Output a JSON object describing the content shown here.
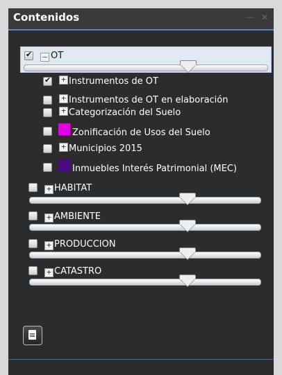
{
  "panel": {
    "title": "Contenidos"
  },
  "groups": [
    {
      "label": "OT",
      "checked": true,
      "expanded": true,
      "opacity_fraction": 0.65
    },
    {
      "label": "HABITAT",
      "checked": false,
      "expanded": false,
      "opacity_fraction": 0.65
    },
    {
      "label": "AMBIENTE",
      "checked": false,
      "expanded": false,
      "opacity_fraction": 0.65
    },
    {
      "label": "PRODUCCION",
      "checked": false,
      "expanded": false,
      "opacity_fraction": 0.65
    },
    {
      "label": "CATASTRO",
      "checked": false,
      "expanded": false,
      "opacity_fraction": 0.65
    }
  ],
  "ot_layers": [
    {
      "label": "Instrumentos de OT",
      "checked": true,
      "type": "expandable"
    },
    {
      "label": "Instrumentos de OT en elaboración",
      "checked": false,
      "type": "expandable"
    },
    {
      "label": "Categorización del Suelo",
      "checked": false,
      "type": "expandable"
    },
    {
      "label": "Zonificación de Usos del Suelo",
      "checked": false,
      "type": "swatch",
      "color": "#e100e6"
    },
    {
      "label": "Municipios 2015",
      "checked": false,
      "type": "expandable"
    },
    {
      "label": "Inmuebles Interés Patrimonial (MEC)",
      "checked": false,
      "type": "swatch",
      "color": "#4a0a84"
    }
  ],
  "colors": {
    "header_bg": "#3a3a3a",
    "panel_bg": "#2c2c2c",
    "accent": "#5a84c6",
    "selected_band": "#dfe8f3"
  },
  "icons": {
    "legend_button": "document-icon",
    "minimize": "minimize-icon",
    "close": "close-icon"
  }
}
